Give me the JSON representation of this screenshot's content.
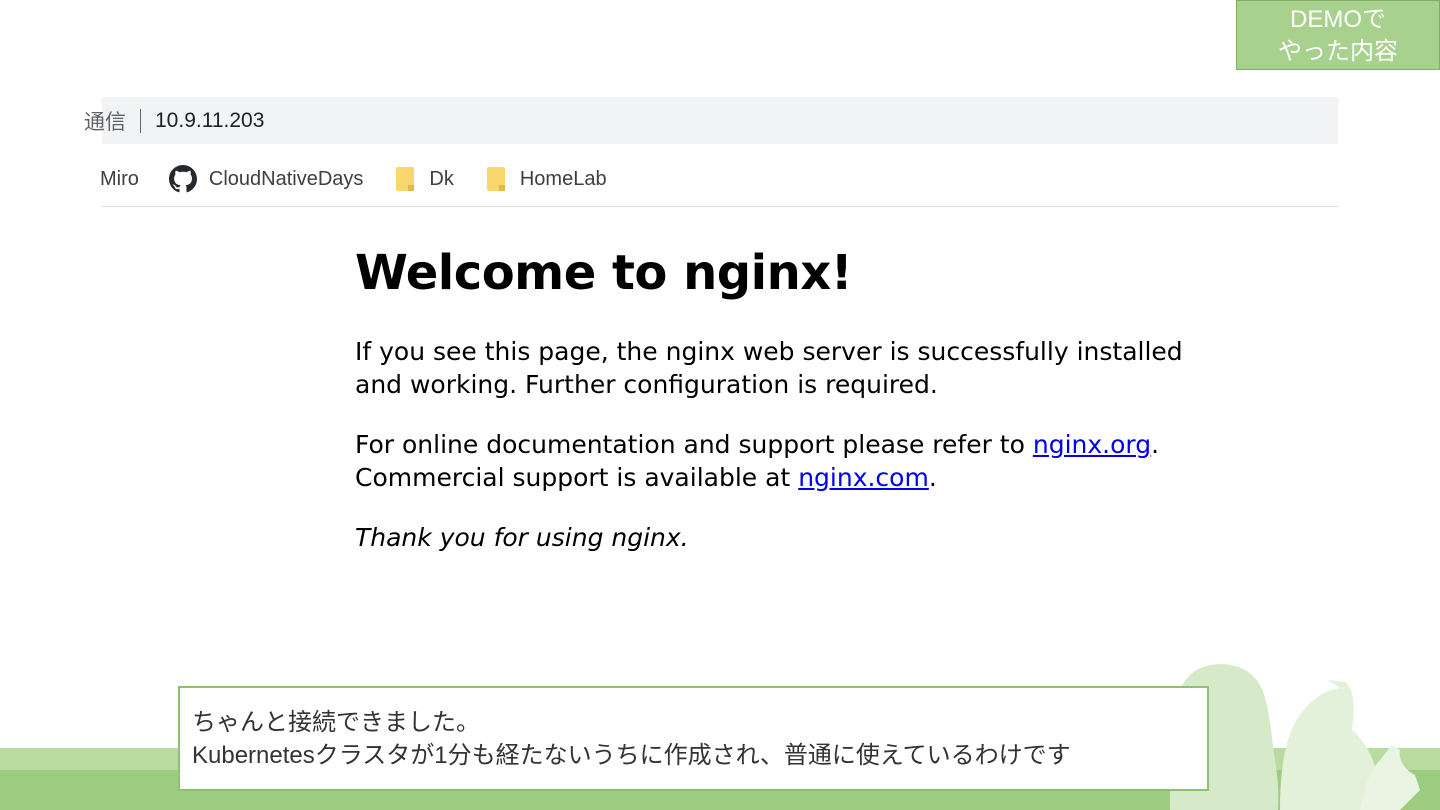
{
  "badge": {
    "line1": "DEMOで",
    "line2": "やった内容"
  },
  "address_bar": {
    "security_label": "通信",
    "url": "10.9.11.203"
  },
  "bookmarks": [
    {
      "label": "Miro",
      "icon": "none"
    },
    {
      "label": "CloudNativeDays",
      "icon": "github-icon"
    },
    {
      "label": "Dk",
      "icon": "folder-icon"
    },
    {
      "label": "HomeLab",
      "icon": "folder-icon"
    }
  ],
  "page": {
    "title": "Welcome to nginx!",
    "para1": "If you see this page, the nginx web server is successfully installed and working. Further configuration is required.",
    "para2_prefix": "For online documentation and support please refer to ",
    "link_org": "nginx.org",
    "para2_mid": ".",
    "para3_prefix": "Commercial support is available at ",
    "link_com": "nginx.com",
    "para3_suffix": ".",
    "thanks": "Thank you for using nginx."
  },
  "caption": {
    "line1": "ちゃんと接続できました。",
    "line2": "Kubernetesクラスタが1分も経たないうちに作成され、普通に使えているわけです"
  },
  "colors": {
    "accent_green": "#a9d18e",
    "link_blue": "#0000ee"
  }
}
